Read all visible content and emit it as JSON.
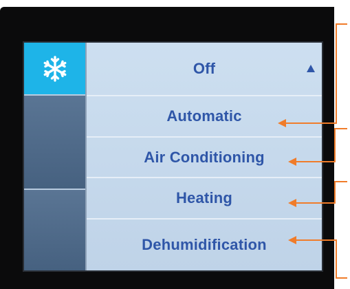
{
  "screen": {
    "sidebar": {
      "tabs": [
        {
          "icon": "snowflake-icon",
          "active": true
        },
        {
          "icon": "",
          "active": false
        },
        {
          "icon": "",
          "active": false
        }
      ]
    },
    "menu": {
      "items": [
        {
          "label": "Off",
          "scroll_indicator": "up-arrow-icon"
        },
        {
          "label": "Automatic"
        },
        {
          "label": "Air Conditioning"
        },
        {
          "label": "Heating"
        },
        {
          "label": "Dehumidification"
        }
      ]
    }
  },
  "colors": {
    "screen_background": "#c4d7ea",
    "active_tab": "#1eb4e8",
    "inactive_tab": "#4f6a8a",
    "menu_text": "#2f56a8",
    "annotation_callout": "#f07c2a",
    "device_bezel": "#0b0b0c"
  }
}
